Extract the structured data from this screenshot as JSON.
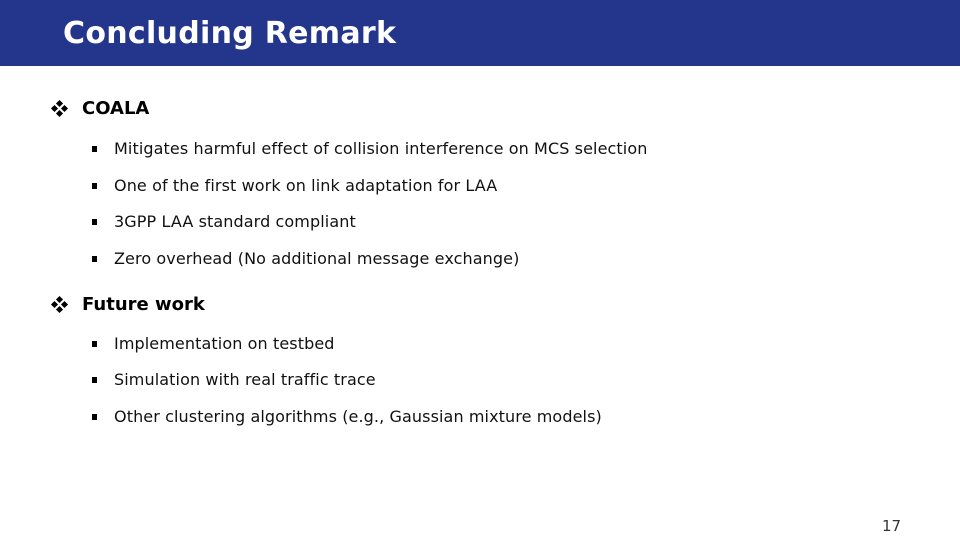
{
  "header": {
    "title": "Concluding Remark",
    "background_color": "#24368c"
  },
  "sections": [
    {
      "label": "COALA",
      "icon": "diamond-bullet-icon",
      "items": [
        "Mitigates harmful effect of collision interference on MCS selection",
        "One of the first work on link adaptation for LAA",
        "3GPP LAA standard compliant",
        "Zero overhead (No additional message exchange)"
      ]
    },
    {
      "label": "Future work",
      "icon": "diamond-bullet-icon",
      "items": [
        "Implementation on testbed",
        "Simulation with real traffic trace",
        "Other clustering algorithms (e.g., Gaussian mixture models)"
      ]
    }
  ],
  "footer": {
    "page_number": "17"
  }
}
